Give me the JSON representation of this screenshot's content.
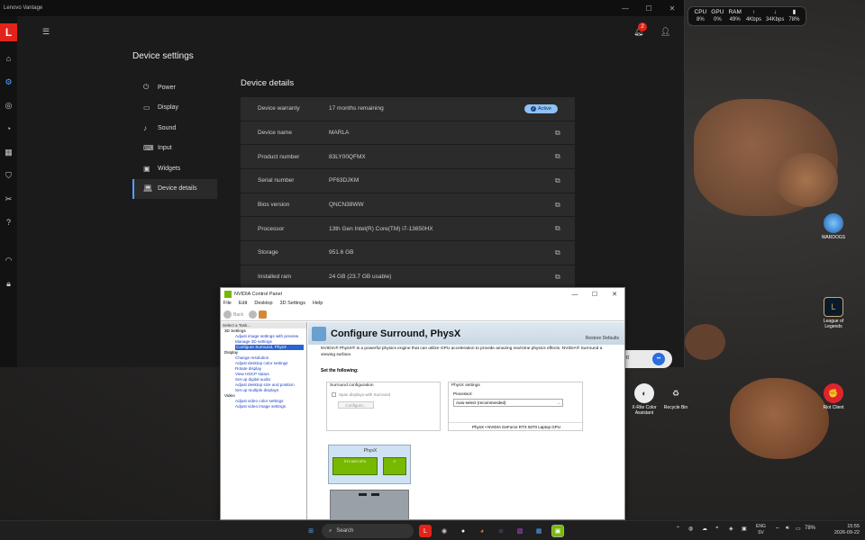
{
  "perf": {
    "cpu_label": "CPU",
    "cpu": "8%",
    "gpu_label": "GPU",
    "gpu": "0%",
    "ram_label": "RAM",
    "ram": "49%",
    "up": "4Kbps",
    "down": "34Kbps",
    "bat": "78%"
  },
  "desktop_icons": {
    "wardogs": "WARDOGS",
    "league": "League of Legends",
    "riot": "Riot Client",
    "xrite": "X-Rite Color Assistant",
    "recycle": "Recycle Bin"
  },
  "vantage": {
    "app_title": "Lenovo Vantage",
    "logo": "L",
    "notif_count": "2",
    "page_title": "Device settings",
    "nav": [
      {
        "label": "Power"
      },
      {
        "label": "Display"
      },
      {
        "label": "Sound"
      },
      {
        "label": "Input"
      },
      {
        "label": "Widgets"
      },
      {
        "label": "Device details"
      }
    ],
    "section_title": "Device details",
    "active_label": "Active",
    "rows": [
      {
        "key": "Device warranty",
        "value": "17 months remaining"
      },
      {
        "key": "Device name",
        "value": "MARLA"
      },
      {
        "key": "Product number",
        "value": "83LY00QFMX"
      },
      {
        "key": "Serial number",
        "value": "PF63DJKM"
      },
      {
        "key": "Bios version",
        "value": "QNCN38WW"
      },
      {
        "key": "Processor",
        "value": "13th Gen Intel(R) Core(TM) i7-13650HX"
      },
      {
        "key": "Storage",
        "value": "951.6 GB"
      },
      {
        "key": "Installed ram",
        "value": "24 GB (23.7 GB usable)"
      }
    ],
    "accent": "#4ea3ff"
  },
  "chat": {
    "fragment": "nt"
  },
  "nvcp": {
    "title": "NVIDIA Control Panel",
    "menu": [
      "File",
      "Edit",
      "Desktop",
      "3D Settings",
      "Help"
    ],
    "back_label": "Back",
    "select_task": "Select a Task...",
    "tree": {
      "g3d": "3D Settings",
      "i1": "Adjust image settings with preview",
      "i2": "Manage 3D settings",
      "i3": "Configure Surround, PhysX",
      "gdisp": "Display",
      "d1": "Change resolution",
      "d2": "Adjust desktop color settings",
      "d3": "Rotate display",
      "d4": "View HDCP status",
      "d5": "Set up digital audio",
      "d6": "Adjust desktop size and position",
      "d7": "Set up multiple displays",
      "gvid": "Video",
      "v1": "Adjust video color settings",
      "v2": "Adjust video image settings"
    },
    "page_title": "Configure Surround, PhysX",
    "restore": "Restore Defaults",
    "description": "NVIDIA® PhysX® is a powerful physics engine that can utilize GPU acceleration to provide amazing real-time physics effects. NVIDIA® Surround a viewing surface.",
    "set_following": "Set the following:",
    "surround_title": "Surround configuration",
    "span_label": "Span displays with Surround",
    "configure_btn": "Configure...",
    "physx_title": "PhysX settings",
    "processor_label": "Processor:",
    "processor_value": "Auto-select (recommended)",
    "gpu_line": "PhysX • NVIDIA GeForce RTX 5070 Laptop GPU",
    "diagram_label": "PhysX",
    "chip1": "RTX 5070 GPU",
    "chip2": "i7"
  },
  "taskbar": {
    "search": "Search",
    "lang_top": "ENG",
    "lang_bottom": "SV",
    "battery": "78%",
    "time": "15:55",
    "date": "2026-09-22"
  }
}
